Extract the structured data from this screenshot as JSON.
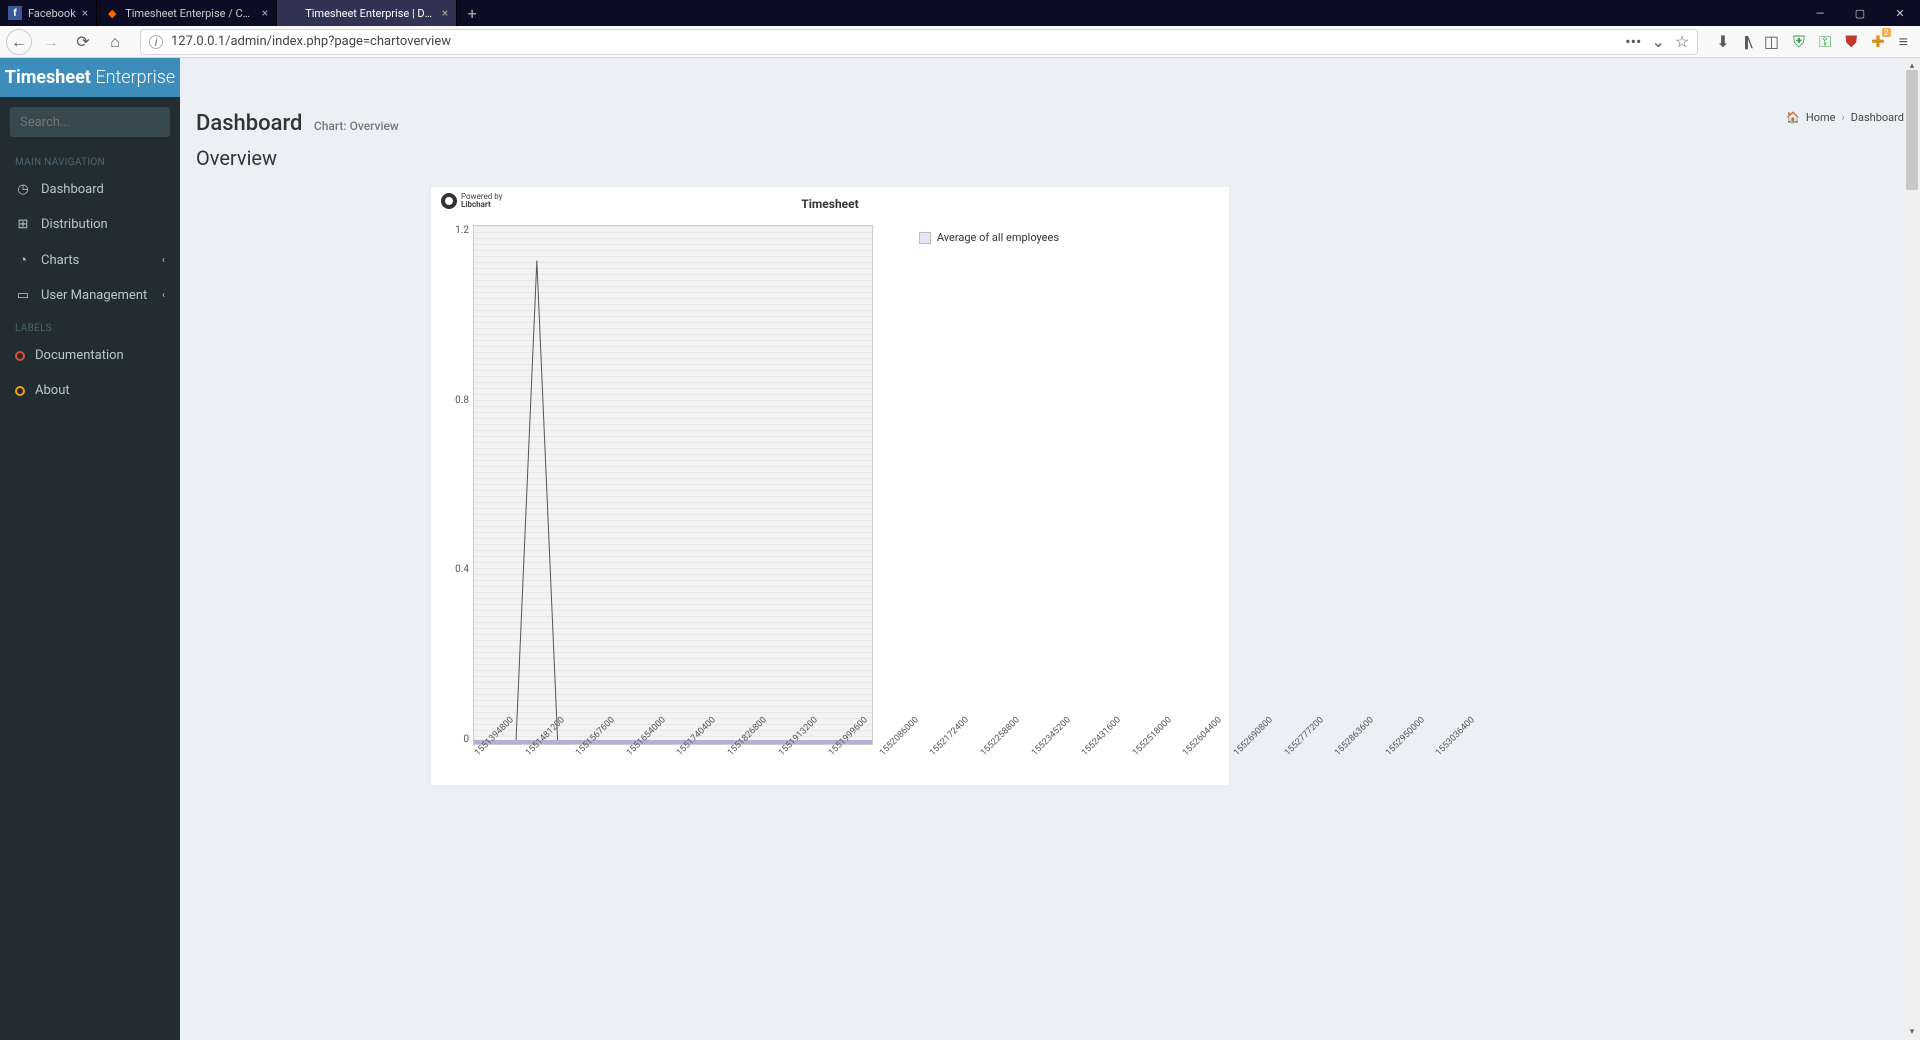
{
  "browser": {
    "tabs": [
      {
        "title": "Facebook",
        "favicon": "f"
      },
      {
        "title": "Timesheet Enterpise / Code / […",
        "favicon": "◆"
      },
      {
        "title": "Timesheet Enterprise | Dashboard",
        "favicon": ""
      }
    ],
    "url": "127.0.0.1/admin/index.php?page=chartoverview"
  },
  "app": {
    "brand_bold": "Timesheet",
    "brand_light": "Enterprise",
    "search_placeholder": "Search..."
  },
  "nav": {
    "main_header": "MAIN NAVIGATION",
    "labels_header": "LABELS",
    "items": [
      {
        "label": "Dashboard"
      },
      {
        "label": "Distribution"
      },
      {
        "label": "Charts"
      },
      {
        "label": "User Management"
      }
    ],
    "label_items": [
      {
        "label": "Documentation"
      },
      {
        "label": "About"
      }
    ]
  },
  "page": {
    "heading": "Dashboard",
    "subheading": "Chart: Overview",
    "breadcrumb_home": "Home",
    "breadcrumb_current": "Dashboard",
    "section": "Overview"
  },
  "chart_data": {
    "type": "line",
    "title": "Timesheet",
    "powered_by": "Powered by",
    "powered_by_name": "Libchart",
    "xlabel": "",
    "ylabel": "",
    "ylim": [
      0,
      1.2
    ],
    "y_ticks": [
      1.2,
      0.8,
      0.4,
      0
    ],
    "x_ticks": [
      "1551394800",
      "1551481200",
      "1551567600",
      "1551654000",
      "1551740400",
      "1551826800",
      "1551913200",
      "1551999600",
      "1552086000",
      "1552172400",
      "1552258800",
      "1552345200",
      "1552431600",
      "1552518000",
      "1552604400",
      "1552690800",
      "1552777200",
      "1552863600",
      "1552950000",
      "1553036400"
    ],
    "series": [
      {
        "name": "Average of all employees",
        "values": [
          0,
          0,
          0,
          1.12,
          0,
          0,
          0,
          0,
          0,
          0,
          0,
          0,
          0,
          0,
          0,
          0,
          0,
          0,
          0,
          0
        ]
      }
    ]
  }
}
